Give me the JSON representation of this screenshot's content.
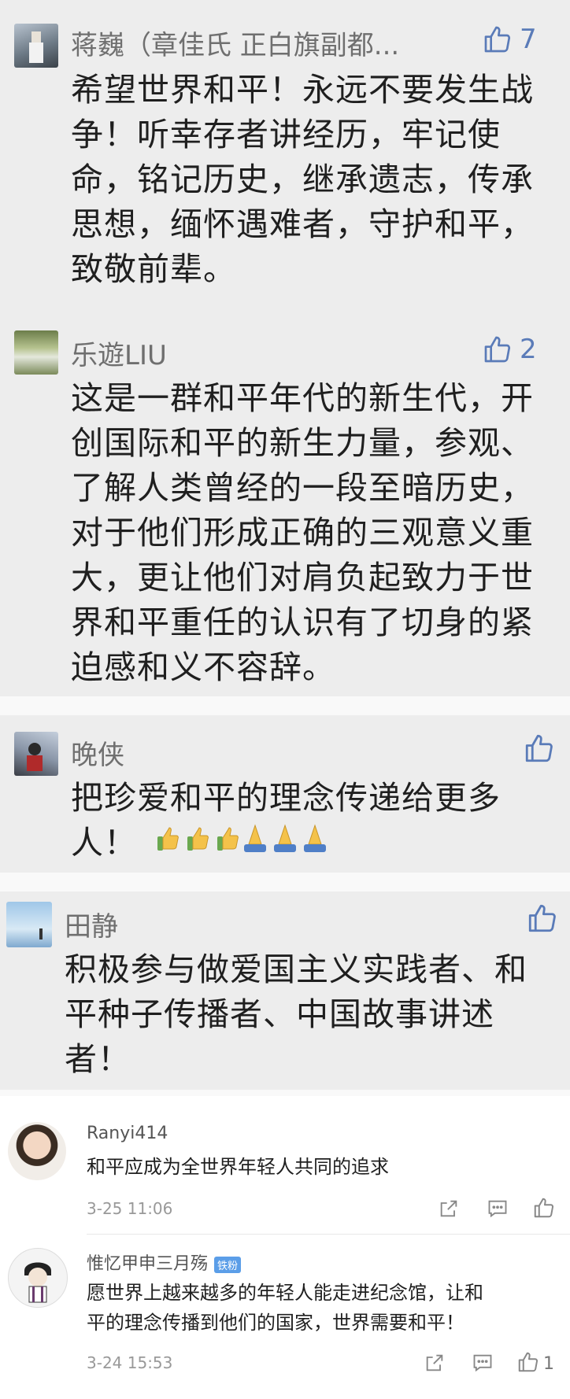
{
  "comments": [
    {
      "name": "蒋巍（章佳氏 正白旗副都...",
      "likes": "7",
      "lines": [
        "希望世界和平！永远不要发生战",
        "争！听幸存者讲经历，牢记使",
        "命，铭记历史，继承遗志，传承",
        "思想，缅怀遇难者，守护和平，",
        "致敬前辈。"
      ]
    },
    {
      "name": "乐遊LIU",
      "likes": "2",
      "lines": [
        "这是一群和平年代的新生代，开",
        "创国际和平的新生力量，参观、",
        "了解人类曾经的一段至暗历史，",
        "对于他们形成正确的三观意义重",
        "大，更让他们对肩负起致力于世",
        "界和平重任的认识有了切身的紧",
        "迫感和义不容辞。"
      ]
    },
    {
      "name": "晚侠",
      "likes": "",
      "lines": [
        "把珍爱和平的理念传递给更多",
        "人！"
      ]
    },
    {
      "name": "田静",
      "likes": "",
      "lines": [
        "积极参与做爱国主义实践者、和",
        "平种子传播者、中国故事讲述",
        "者！"
      ]
    }
  ],
  "weibo": [
    {
      "name": "Ranyi414",
      "badge": "",
      "text": [
        "和平应成为全世界年轻人共同的追求"
      ],
      "time": "3-25 11:06",
      "likes": ""
    },
    {
      "name": "惟忆甲申三月殇",
      "badge": "铁粉",
      "text": [
        "愿世界上越来越多的年轻人能走进纪念馆，让和",
        "平的理念传播到他们的国家，世界需要和平！"
      ],
      "time": "3-24 15:53",
      "likes": "1"
    }
  ],
  "icons": {
    "like": "thumbs-up-icon",
    "share": "share-icon",
    "reply": "comment-icon"
  },
  "colors": {
    "accent": "#5a7bb8",
    "block_bg": "#ededed"
  }
}
